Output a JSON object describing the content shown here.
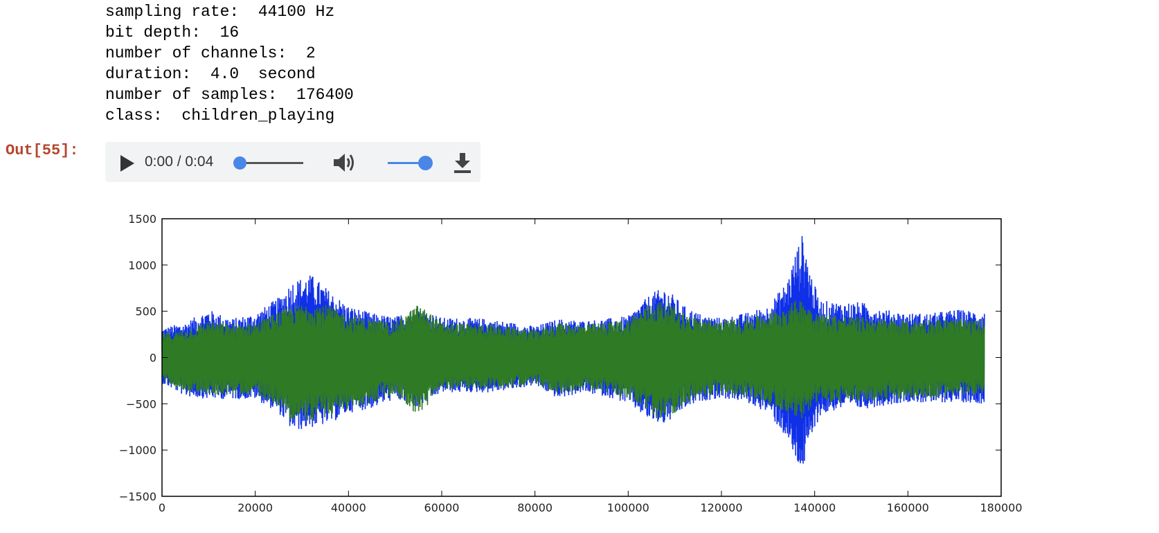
{
  "output": {
    "lines": [
      "sampling rate:  44100 Hz",
      "bit depth:  16",
      "number of channels:  2",
      "duration:  4.0  second",
      "number of samples:  176400",
      "class:  children_playing"
    ],
    "prompt": "Out[55]:"
  },
  "audio_player": {
    "time_display": "0:00 / 0:04",
    "progress": 0.0,
    "volume": 1.0,
    "icons": {
      "play": "play-icon",
      "volume": "volume-icon",
      "download": "download-icon"
    }
  },
  "chart_data": {
    "type": "line",
    "title": "",
    "xlabel": "",
    "ylabel": "",
    "xlim": [
      0,
      180000
    ],
    "ylim": [
      -1500,
      1500
    ],
    "xticks": [
      0,
      20000,
      40000,
      60000,
      80000,
      100000,
      120000,
      140000,
      160000,
      180000
    ],
    "yticks": [
      1500,
      1000,
      500,
      0,
      -500,
      -1000,
      -1500
    ],
    "grid": false,
    "legend": "none",
    "x_extent": [
      0,
      176400
    ],
    "series": [
      {
        "color": "#1030e8",
        "envelope_x": [
          0,
          5000,
          10000,
          15000,
          20000,
          25000,
          28000,
          32000,
          36000,
          40000,
          45000,
          50000,
          55000,
          60000,
          65000,
          70000,
          75000,
          80000,
          85000,
          90000,
          95000,
          100000,
          105000,
          108000,
          112000,
          116000,
          120000,
          125000,
          130000,
          134000,
          136000,
          137500,
          139000,
          141000,
          145000,
          150000,
          155000,
          160000,
          165000,
          170000,
          176400
        ],
        "upper": [
          320,
          380,
          520,
          420,
          480,
          650,
          830,
          900,
          720,
          560,
          480,
          440,
          560,
          430,
          430,
          420,
          380,
          340,
          420,
          400,
          420,
          450,
          700,
          760,
          560,
          460,
          430,
          480,
          560,
          820,
          1150,
          1350,
          950,
          620,
          600,
          600,
          520,
          480,
          480,
          520,
          500
        ],
        "lower": [
          -280,
          -420,
          -450,
          -450,
          -450,
          -600,
          -800,
          -760,
          -720,
          -600,
          -550,
          -450,
          -550,
          -380,
          -380,
          -380,
          -350,
          -300,
          -450,
          -380,
          -420,
          -500,
          -700,
          -730,
          -560,
          -470,
          -440,
          -480,
          -600,
          -880,
          -1150,
          -1220,
          -950,
          -640,
          -560,
          -560,
          -520,
          -480,
          -500,
          -480,
          -500
        ]
      },
      {
        "color": "#2f7a24",
        "envelope_x": [
          0,
          5000,
          10000,
          15000,
          20000,
          25000,
          28000,
          32000,
          36000,
          40000,
          45000,
          50000,
          55000,
          60000,
          65000,
          70000,
          75000,
          80000,
          85000,
          90000,
          95000,
          100000,
          105000,
          108000,
          112000,
          116000,
          120000,
          125000,
          130000,
          134000,
          136000,
          137500,
          139000,
          141000,
          145000,
          150000,
          155000,
          160000,
          165000,
          170000,
          176400
        ],
        "upper": [
          260,
          300,
          400,
          360,
          380,
          500,
          560,
          600,
          560,
          460,
          420,
          380,
          580,
          380,
          370,
          360,
          330,
          300,
          380,
          360,
          380,
          420,
          600,
          620,
          480,
          420,
          400,
          430,
          480,
          560,
          620,
          640,
          560,
          480,
          460,
          440,
          420,
          400,
          420,
          420,
          400
        ],
        "lower": [
          -240,
          -360,
          -400,
          -400,
          -400,
          -520,
          -700,
          -680,
          -640,
          -560,
          -500,
          -400,
          -640,
          -340,
          -340,
          -340,
          -320,
          -280,
          -400,
          -340,
          -380,
          -440,
          -640,
          -700,
          -500,
          -420,
          -400,
          -420,
          -500,
          -600,
          -640,
          -660,
          -560,
          -480,
          -500,
          -480,
          -460,
          -440,
          -440,
          -420,
          -400
        ]
      }
    ]
  }
}
